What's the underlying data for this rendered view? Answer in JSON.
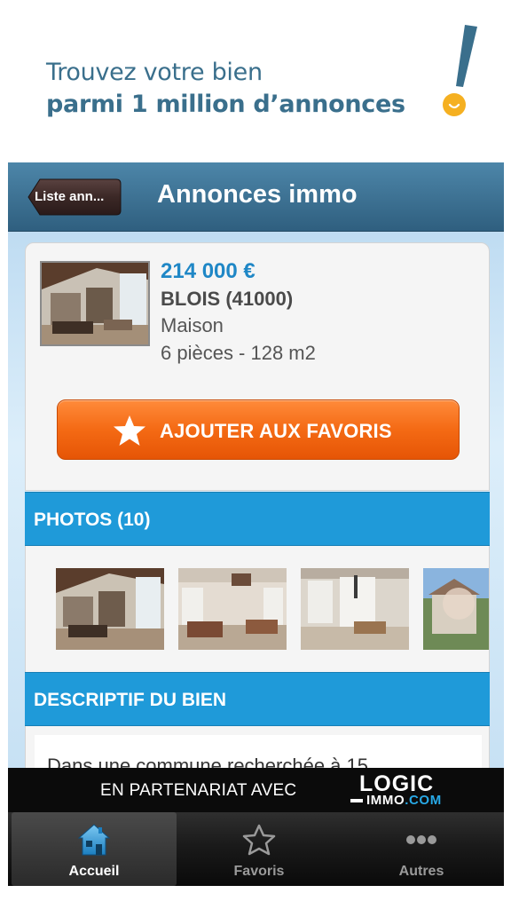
{
  "promo": {
    "line1": "Trouvez votre bien",
    "line2": "parmi 1 million d’annonces",
    "accent_color": "#f5b021",
    "text_color": "#3a6f8c"
  },
  "navbar": {
    "back_label": "Liste ann...",
    "title": "Annonces immo"
  },
  "listing": {
    "price": "214 000 €",
    "city": "BLOIS (41000)",
    "type": "Maison",
    "details": "6 pièces - 128 m2",
    "favorite_button": "AJOUTER AUX FAVORIS",
    "favorite_icon": "star-icon"
  },
  "photos": {
    "header": "PHOTOS (10)",
    "thumbnails": [
      "photo-living-room-1",
      "photo-living-room-2",
      "photo-living-room-3",
      "photo-exterior"
    ]
  },
  "description": {
    "header": "DESCRIPTIF DU BIEN",
    "text": "Dans une commune recherchée à 15"
  },
  "banner": {
    "text": "EN PARTENARIAT AVEC",
    "logo_top": "LOGIC",
    "logo_bottom": "IMMO",
    "logo_suffix": ".COM"
  },
  "tabbar": {
    "tabs": [
      {
        "label": "Accueil",
        "icon": "house-icon",
        "active": true
      },
      {
        "label": "Favoris",
        "icon": "star-outline-icon",
        "active": false
      },
      {
        "label": "Autres",
        "icon": "more-dots-icon",
        "active": false
      }
    ]
  },
  "colors": {
    "accent_orange": "#f46a14",
    "section_blue": "#1f9ad9",
    "price_blue": "#1f87c6",
    "navbar_blue": "#3d7496"
  }
}
